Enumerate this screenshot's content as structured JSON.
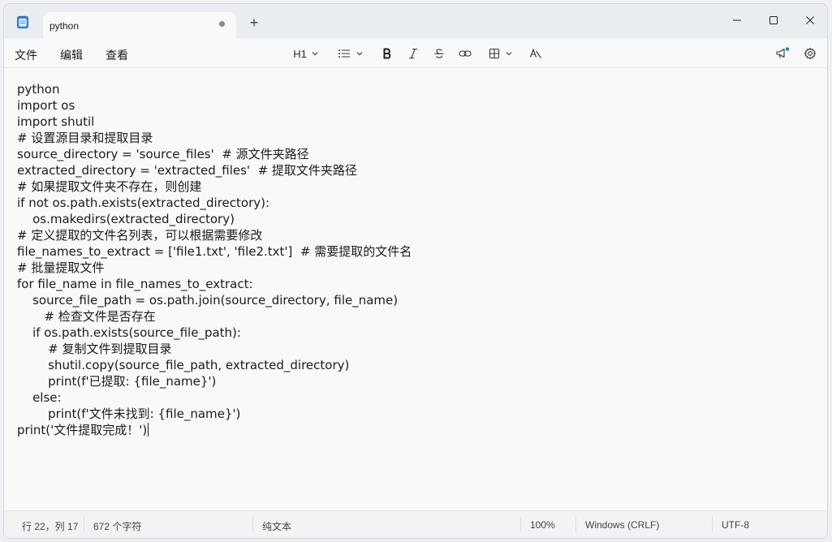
{
  "tab": {
    "title": "python",
    "new_tab_glyph": "+"
  },
  "window_controls": [
    "minimize-icon",
    "maximize-icon",
    "close-icon"
  ],
  "menu": {
    "file": "文件",
    "edit": "编辑",
    "view": "查看"
  },
  "toolbar": {
    "heading": "H1",
    "items": [
      "heading-dropdown",
      "list-icon",
      "bold-icon",
      "italic-icon",
      "strikethrough-icon",
      "link-icon",
      "table-icon",
      "clear-formatting-icon"
    ],
    "right": [
      "announcement-icon",
      "settings-icon"
    ],
    "accent": "#0067c0"
  },
  "editor": {
    "lines": [
      "python",
      "import os",
      "import shutil",
      "# 设置源目录和提取目录",
      "source_directory = 'source_files'  # 源文件夹路径",
      "extracted_directory = 'extracted_files'  # 提取文件夹路径",
      "# 如果提取文件夹不存在，则创建",
      "if not os.path.exists(extracted_directory):",
      "    os.makedirs(extracted_directory)",
      "# 定义提取的文件名列表，可以根据需要修改",
      "file_names_to_extract = ['file1.txt', 'file2.txt']  # 需要提取的文件名",
      "# 批量提取文件",
      "for file_name in file_names_to_extract:",
      "    source_file_path = os.path.join(source_directory, file_name)",
      "       # 检查文件是否存在",
      "    if os.path.exists(source_file_path):",
      "        # 复制文件到提取目录",
      "        shutil.copy(source_file_path, extracted_directory)",
      "        print(f'已提取: {file_name}')",
      "    else:",
      "        print(f'文件未找到: {file_name}')",
      "print('文件提取完成！')"
    ]
  },
  "status": {
    "position": "行 22，列 17",
    "chars": "672 个字符",
    "format": "纯文本",
    "zoom": "100%",
    "line_ending": "Windows (CRLF)",
    "encoding": "UTF-8"
  }
}
